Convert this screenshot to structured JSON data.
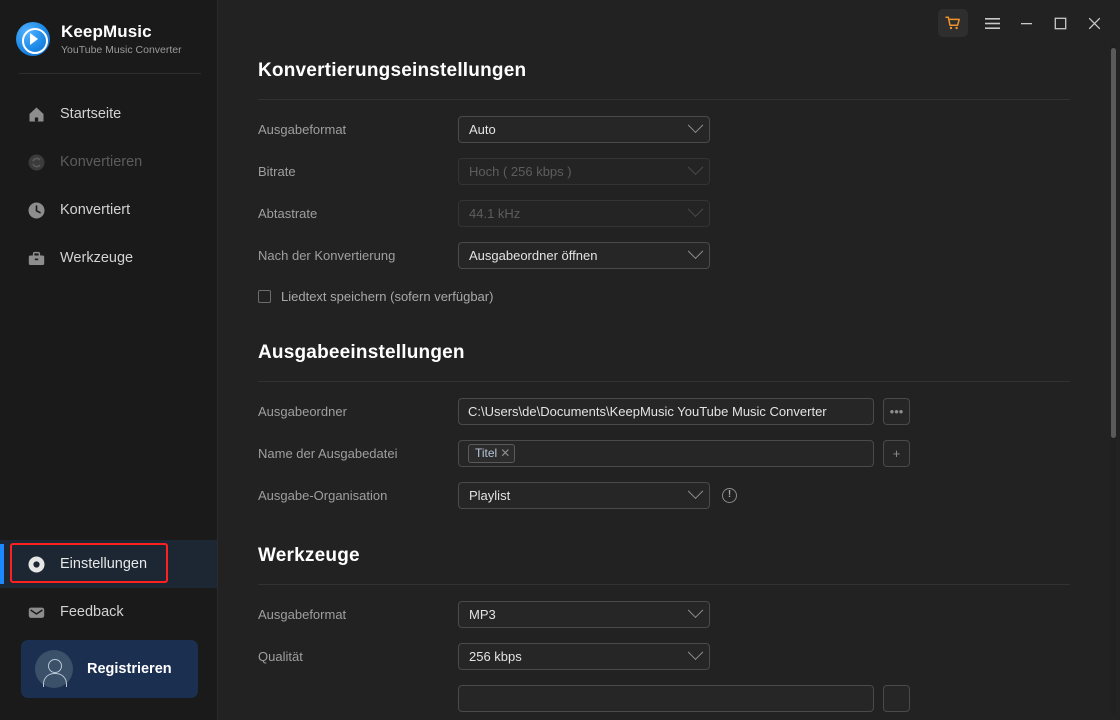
{
  "brand": {
    "name": "KeepMusic",
    "subtitle": "YouTube Music Converter",
    "logo_icon": "play-circle-logo-icon",
    "logo_color": "#1e8ae8"
  },
  "titlebar": {
    "buttons": [
      {
        "name": "cart-button",
        "icon": "shopping-cart-icon",
        "label": "",
        "color": "#f0922b"
      },
      {
        "name": "menu-button",
        "icon": "hamburger-menu-icon",
        "label": ""
      },
      {
        "name": "minimize-button",
        "icon": "minimize-icon",
        "label": ""
      },
      {
        "name": "maximize-button",
        "icon": "maximize-icon",
        "label": ""
      },
      {
        "name": "close-button",
        "icon": "close-icon",
        "label": ""
      }
    ]
  },
  "sidebar": {
    "items": [
      {
        "label": "Startseite",
        "icon": "home-icon",
        "state": "normal"
      },
      {
        "label": "Konvertieren",
        "icon": "convert-refresh-icon",
        "state": "disabled"
      },
      {
        "label": "Konvertiert",
        "icon": "clock-history-icon",
        "state": "normal"
      },
      {
        "label": "Werkzeuge",
        "icon": "toolbox-icon",
        "state": "normal"
      }
    ],
    "bottom_items": [
      {
        "label": "Einstellungen",
        "icon": "settings-gear-icon",
        "state": "active"
      },
      {
        "label": "Feedback",
        "icon": "envelope-icon",
        "state": "normal"
      }
    ],
    "register": {
      "label": "Registrieren",
      "icon": "user-avatar-icon",
      "background": "#1b3050"
    },
    "active_indicator_color": "#1e88ff",
    "annotation_color": "#ff2020"
  },
  "main": {
    "sections": [
      {
        "title": "Konvertierungseinstellungen",
        "rows": [
          {
            "label": "Ausgabeformat",
            "value": "Auto",
            "control": "select",
            "disabled": false
          },
          {
            "label": "Bitrate",
            "value": "Hoch ( 256 kbps )",
            "control": "select",
            "disabled": true
          },
          {
            "label": "Abtastrate",
            "value": "44.1 kHz",
            "control": "select",
            "disabled": true
          },
          {
            "label": "Nach der Konvertierung",
            "value": "Ausgabeordner öffnen",
            "control": "select",
            "disabled": false
          }
        ],
        "checkbox": {
          "label": "Liedtext speichern (sofern verfügbar)",
          "checked": false
        }
      },
      {
        "title": "Ausgabeeinstellungen",
        "output_folder": {
          "label": "Ausgabeordner",
          "value": "C:\\Users\\de\\Documents\\KeepMusic YouTube Music Converter",
          "browse_label": "•••"
        },
        "output_filename": {
          "label": "Name der Ausgabedatei",
          "chip": "Titel",
          "chip_remove": "✕",
          "add_label": "+"
        },
        "output_organisation": {
          "label": "Ausgabe-Organisation",
          "value": "Playlist",
          "info_icon": "info-circle-icon",
          "info_glyph": "!"
        }
      },
      {
        "title": "Werkzeuge",
        "rows": [
          {
            "label": "Ausgabeformat",
            "value": "MP3",
            "control": "select",
            "disabled": false
          },
          {
            "label": "Qualität",
            "value": "256 kbps",
            "control": "select",
            "disabled": false
          }
        ]
      }
    ]
  }
}
